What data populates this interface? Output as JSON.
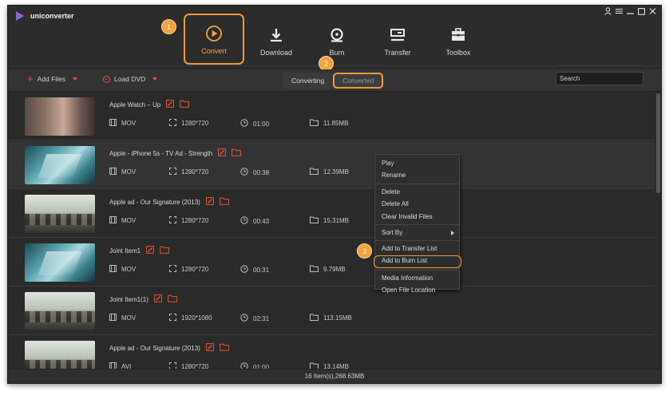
{
  "app": {
    "name": "uniconverter"
  },
  "window_controls": [
    "user-icon",
    "menu-icon",
    "minimize-icon",
    "maximize-icon",
    "close-icon"
  ],
  "main_tabs": [
    {
      "label": "Convert",
      "icon": "convert-icon",
      "active": true
    },
    {
      "label": "Download",
      "icon": "download-icon",
      "active": false
    },
    {
      "label": "Burn",
      "icon": "burn-icon",
      "active": false
    },
    {
      "label": "Transfer",
      "icon": "transfer-icon",
      "active": false
    },
    {
      "label": "Toolbox",
      "icon": "toolbox-icon",
      "active": false
    }
  ],
  "badges": [
    "1",
    "2",
    "3"
  ],
  "toolbar": {
    "add_files": "Add Files",
    "load_dvd": "Load DVD",
    "converting": "Converting",
    "converted": "Converted",
    "search_placeholder": "Search"
  },
  "files": [
    {
      "title": "Apple Watch – Up",
      "format": "MOV",
      "resolution": "1280*720",
      "duration": "01:00",
      "size": "11.85MB",
      "thumb": "watch"
    },
    {
      "title": "Apple - iPhone 5s - TV Ad - Strength",
      "format": "MOV",
      "resolution": "1280*720",
      "duration": "00:38",
      "size": "12.39MB",
      "thumb": "iphone"
    },
    {
      "title": "Apple ad - Our Signature (2013)",
      "format": "MOV",
      "resolution": "1280*720",
      "duration": "00:43",
      "size": "15.31MB",
      "thumb": "class"
    },
    {
      "title": "Joint Item1",
      "format": "MOV",
      "resolution": "1280*720",
      "duration": "00:31",
      "size": "9.79MB",
      "thumb": "iphone"
    },
    {
      "title": "Joint Item1(1)",
      "format": "MOV",
      "resolution": "1920*1080",
      "duration": "02:31",
      "size": "113.15MB",
      "thumb": "class"
    },
    {
      "title": "Apple ad - Our Signature (2013)",
      "format": "AVI",
      "resolution": "1280*720",
      "duration": "01:00",
      "size": "13.14MB",
      "thumb": "class"
    }
  ],
  "context_menu": {
    "play": "Play",
    "rename": "Rename",
    "delete": "Delete",
    "delete_all": "Delete All",
    "clear_invalid": "Clear Invalid Files",
    "sort_by": "Sort By",
    "add_transfer": "Add to Transfer List",
    "add_burn": "Add to Burn List",
    "media_info": "Media Information",
    "open_location": "Open File Location"
  },
  "status": "16 Item(s),268.63MB",
  "colors": {
    "accent_orange": "#ee9a3d",
    "icon_red": "#e2543b",
    "background": "#2a2a2a",
    "logo_purple": "#8e5fe0"
  }
}
